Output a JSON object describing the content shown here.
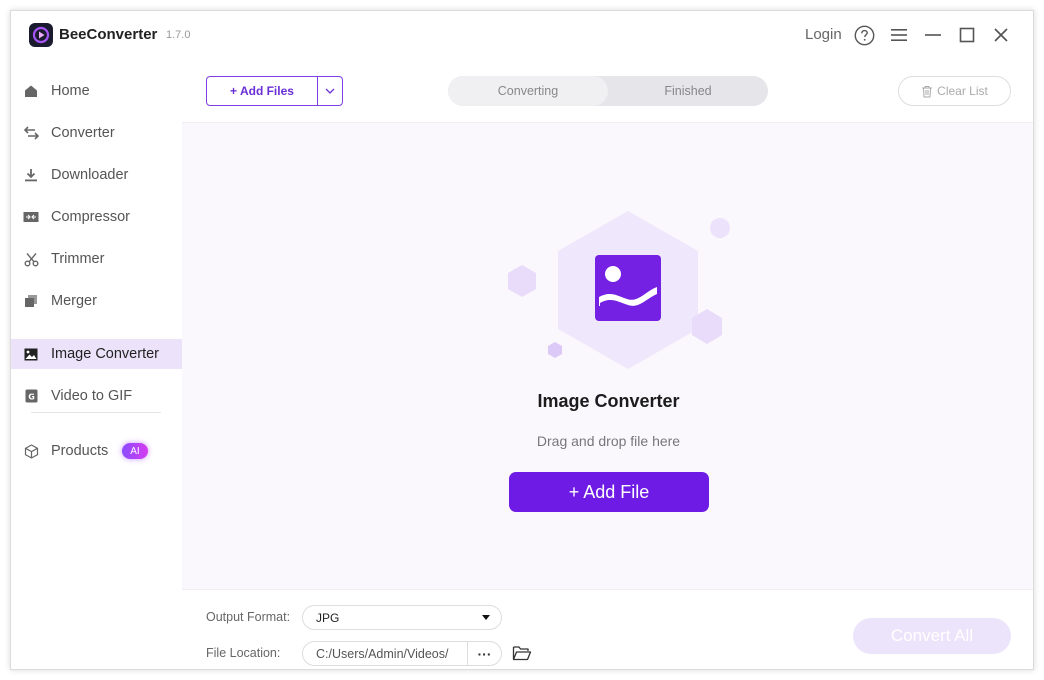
{
  "app": {
    "name": "BeeConverter",
    "version": "1.7.0",
    "login_label": "Login"
  },
  "sidebar": {
    "items": [
      {
        "label": "Home",
        "icon": "home-icon"
      },
      {
        "label": "Converter",
        "icon": "swap-icon"
      },
      {
        "label": "Downloader",
        "icon": "download-icon"
      },
      {
        "label": "Compressor",
        "icon": "compress-icon"
      },
      {
        "label": "Trimmer",
        "icon": "scissors-icon"
      },
      {
        "label": "Merger",
        "icon": "merge-icon"
      },
      {
        "label": "Image Converter",
        "icon": "image-icon",
        "active": true
      },
      {
        "label": "Video to GIF",
        "icon": "gif-icon"
      }
    ],
    "products_label": "Products",
    "ai_badge": "AI"
  },
  "toolbar": {
    "add_files_label": "+ Add Files",
    "tabs": [
      {
        "label": "Converting",
        "active": true
      },
      {
        "label": "Finished",
        "active": false
      }
    ],
    "clear_list_label": "Clear List"
  },
  "dropzone": {
    "title": "Image Converter",
    "subtitle": "Drag and drop file here",
    "add_file_label": "+ Add File"
  },
  "bottom": {
    "output_format_label": "Output Format:",
    "output_format_value": "JPG",
    "file_location_label": "File Location:",
    "file_location_value": "C:/Users/Admin/Videos/",
    "more_label": "···",
    "convert_all_label": "Convert All"
  },
  "colors": {
    "accent": "#6e1be6",
    "active_bg": "#ece3fb",
    "disabled_btn": "#ece4fb"
  }
}
